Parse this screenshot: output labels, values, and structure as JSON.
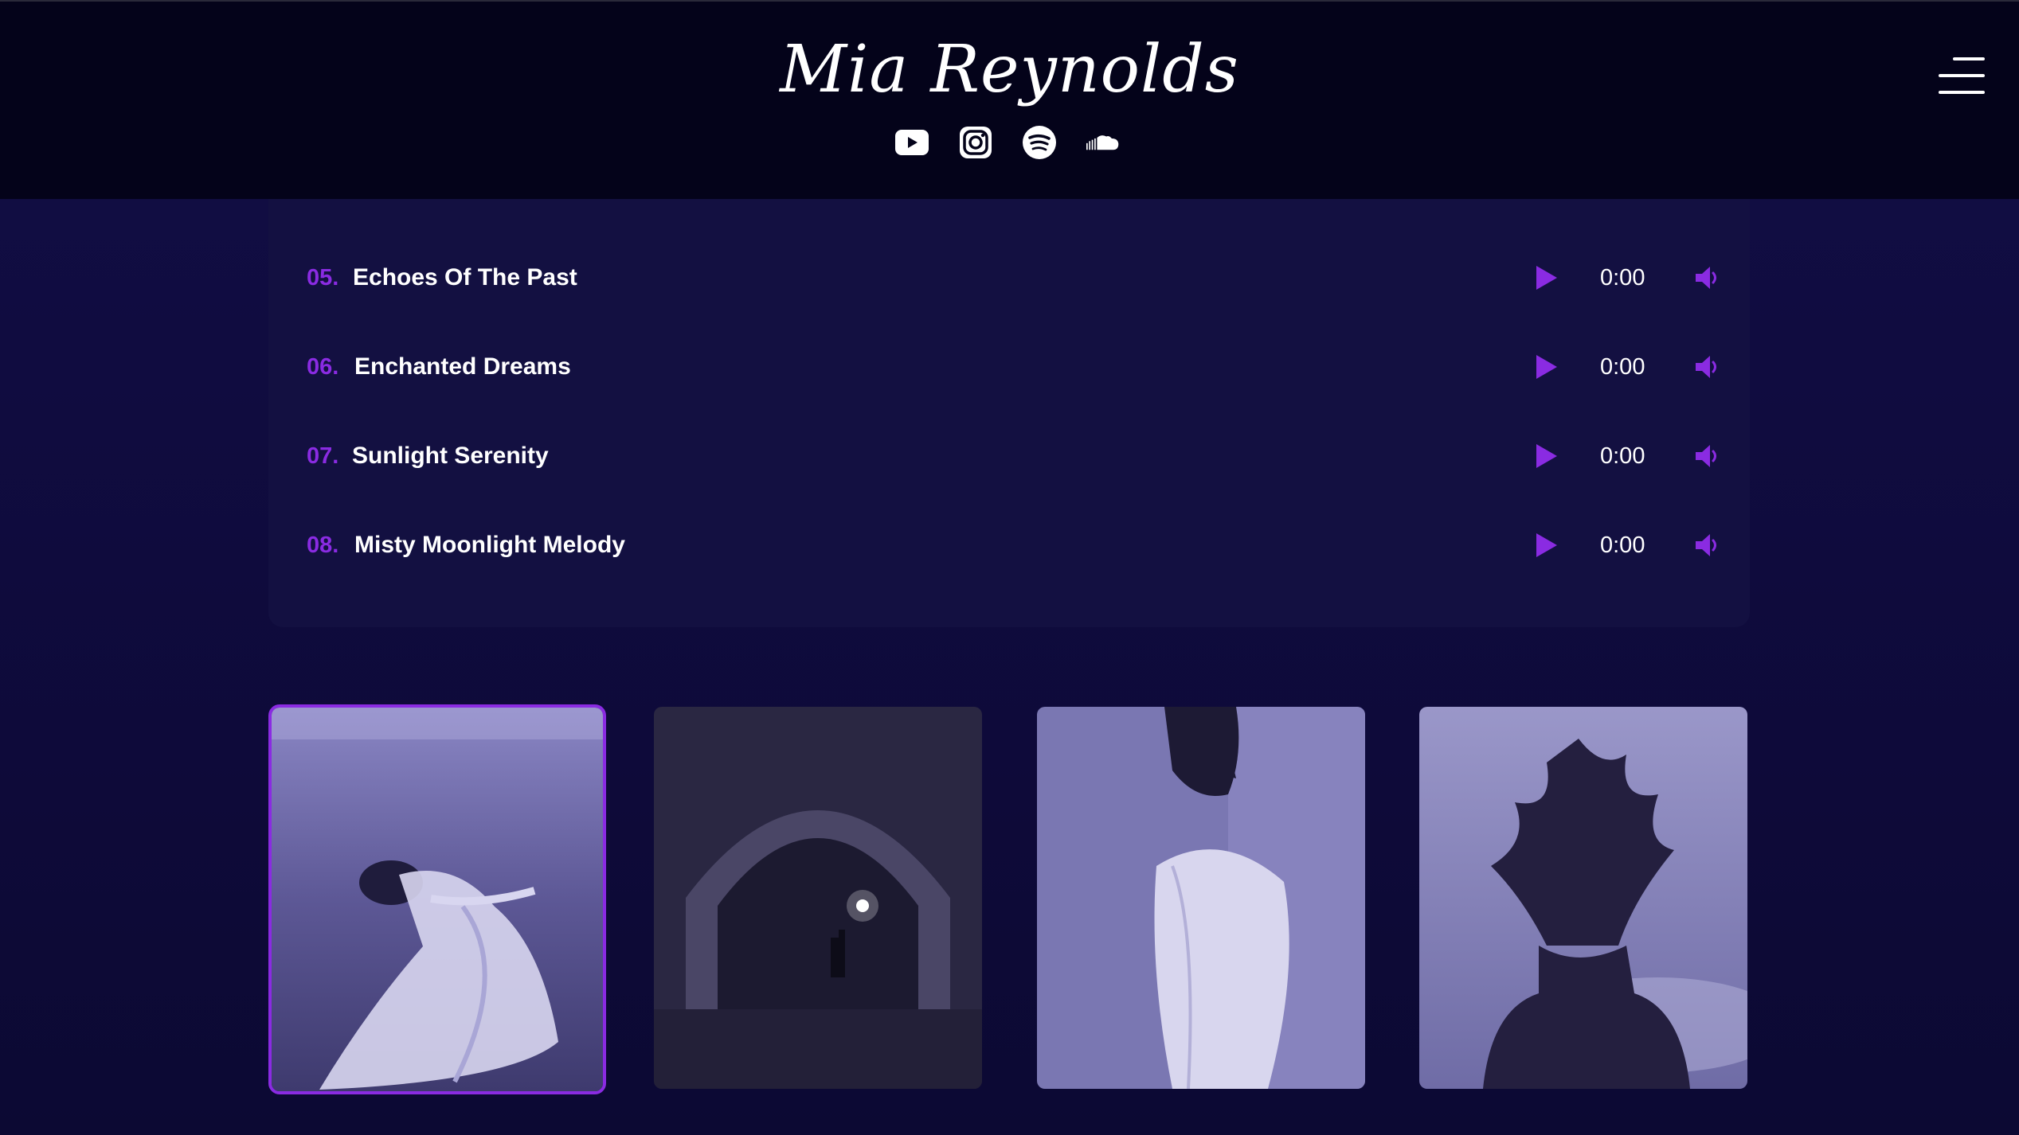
{
  "header": {
    "artist_name": "Mia Reynolds",
    "socials": [
      {
        "name": "youtube",
        "icon": "youtube-icon"
      },
      {
        "name": "instagram",
        "icon": "instagram-icon"
      },
      {
        "name": "spotify",
        "icon": "spotify-icon"
      },
      {
        "name": "soundcloud",
        "icon": "soundcloud-icon"
      }
    ],
    "menu_icon": "hamburger-menu-icon"
  },
  "tracklist": {
    "tracks": [
      {
        "number": "05.",
        "title": "Echoes Of The Past",
        "time": "0:00"
      },
      {
        "number": "06.",
        "title": "Enchanted Dreams",
        "time": "0:00"
      },
      {
        "number": "07.",
        "title": "Sunlight Serenity",
        "time": "0:00"
      },
      {
        "number": "08.",
        "title": "Misty Moonlight Melody",
        "time": "0:00"
      }
    ]
  },
  "gallery": {
    "selected_index": 0,
    "images": [
      {
        "icon": "underwater-woman-photo"
      },
      {
        "icon": "stone-arch-torch-photo"
      },
      {
        "icon": "woman-white-dress-photo"
      },
      {
        "icon": "flowing-hair-silhouette-photo"
      }
    ]
  },
  "colors": {
    "accent": "#8a2be2",
    "background": "#0e0b38",
    "header_bg": "#04031a",
    "panel_bg": "#131041",
    "text": "#ffffff"
  }
}
